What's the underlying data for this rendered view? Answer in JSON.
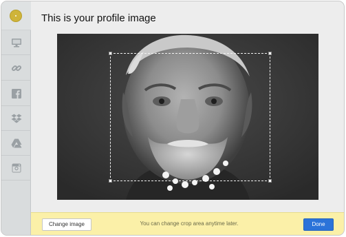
{
  "dialog": {
    "title": "This is your profile image"
  },
  "sidebar": {
    "items": [
      {
        "icon": "monitor-icon"
      },
      {
        "icon": "link-icon"
      },
      {
        "icon": "facebook-icon"
      },
      {
        "icon": "dropbox-icon"
      },
      {
        "icon": "google-drive-icon"
      },
      {
        "icon": "instagram-icon"
      }
    ]
  },
  "footer": {
    "change_label": "Change image",
    "hint": "You can change crop area anytime later.",
    "done_label": "Done"
  },
  "colors": {
    "accent": "#2b73d9",
    "footer_bg": "#fbf0a8",
    "sidebar_bg": "#d9dcdd",
    "logo": "#cfb43a"
  }
}
